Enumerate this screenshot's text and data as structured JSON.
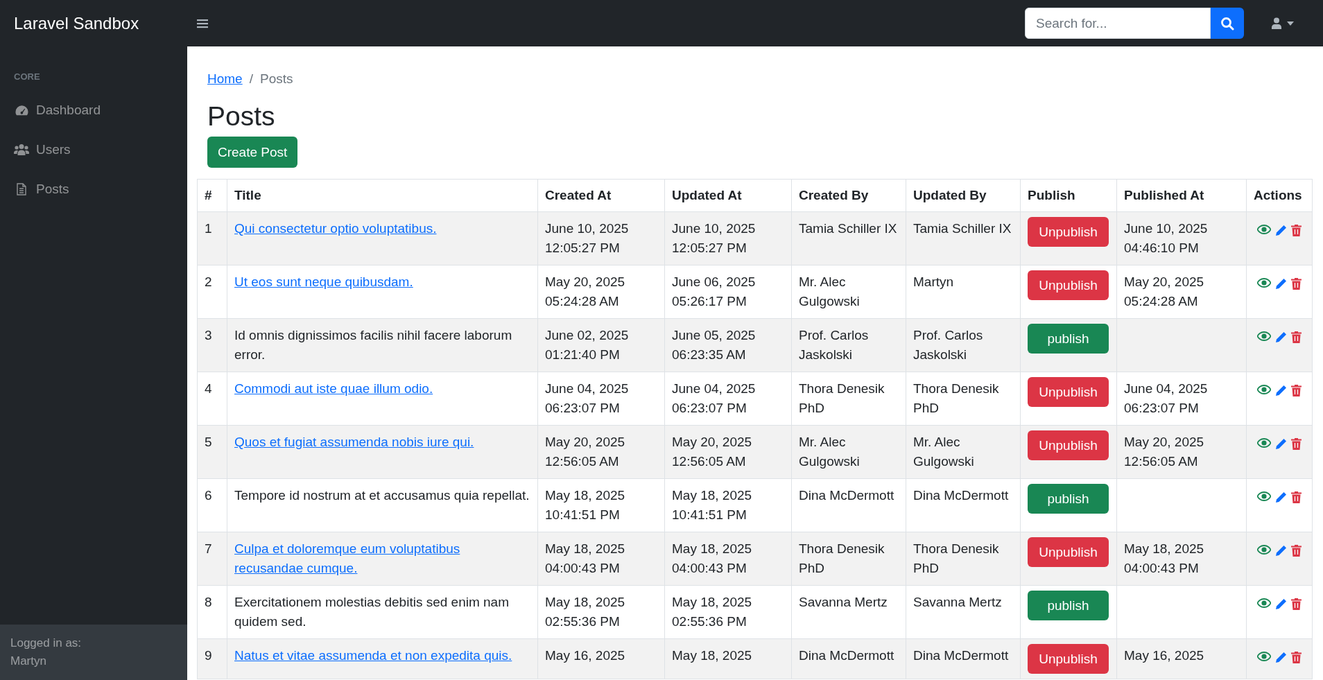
{
  "brand": "Laravel Sandbox",
  "search": {
    "placeholder": "Search for..."
  },
  "sidebar": {
    "heading": "CORE",
    "items": [
      {
        "label": "Dashboard",
        "kind": "dashboard",
        "selected": false
      },
      {
        "label": "Users",
        "kind": "users",
        "selected": false
      },
      {
        "label": "Posts",
        "kind": "posts",
        "selected": false
      }
    ],
    "footer": {
      "label": "Logged in as:",
      "user": "Martyn"
    }
  },
  "breadcrumb": {
    "items": [
      {
        "label": "Home",
        "link": true
      },
      {
        "label": "Posts",
        "link": false
      }
    ],
    "separator": "/"
  },
  "page_title": "Posts",
  "create_button": "Create Post",
  "table": {
    "columns": [
      "#",
      "Title",
      "Created At",
      "Updated At",
      "Created By",
      "Updated By",
      "Publish",
      "Published At",
      "Actions"
    ],
    "rows": [
      {
        "num": "1",
        "title": "Qui consectetur optio voluptatibus.",
        "link": true,
        "created_at": "June 10, 2025 12:05:27 PM",
        "updated_at": "June 10, 2025 12:05:27 PM",
        "created_by": "Tamia Schiller IX",
        "updated_by": "Tamia Schiller IX",
        "publish": {
          "kind": "unpublish",
          "label": "Unpublish"
        },
        "published_at": "June 10, 2025 04:46:10 PM"
      },
      {
        "num": "2",
        "title": "Ut eos sunt neque quibusdam.",
        "link": true,
        "created_at": "May 20, 2025 05:24:28 AM",
        "updated_at": "June 06, 2025 05:26:17 PM",
        "created_by": "Mr. Alec Gulgowski",
        "updated_by": "Martyn",
        "publish": {
          "kind": "unpublish",
          "label": "Unpublish"
        },
        "published_at": "May 20, 2025 05:24:28 AM"
      },
      {
        "num": "3",
        "title": "Id omnis dignissimos facilis nihil facere laborum error.",
        "link": false,
        "created_at": "June 02, 2025 01:21:40 PM",
        "updated_at": "June 05, 2025 06:23:35 AM",
        "created_by": "Prof. Carlos Jaskolski",
        "updated_by": "Prof. Carlos Jaskolski",
        "publish": {
          "kind": "publish",
          "label": "publish"
        },
        "published_at": ""
      },
      {
        "num": "4",
        "title": "Commodi aut iste quae illum odio.",
        "link": true,
        "created_at": "June 04, 2025 06:23:07 PM",
        "updated_at": "June 04, 2025 06:23:07 PM",
        "created_by": "Thora Denesik PhD",
        "updated_by": "Thora Denesik PhD",
        "publish": {
          "kind": "unpublish",
          "label": "Unpublish"
        },
        "published_at": "June 04, 2025 06:23:07 PM"
      },
      {
        "num": "5",
        "title": "Quos et fugiat assumenda nobis iure qui.",
        "link": true,
        "created_at": "May 20, 2025 12:56:05 AM",
        "updated_at": "May 20, 2025 12:56:05 AM",
        "created_by": "Mr. Alec Gulgowski",
        "updated_by": "Mr. Alec Gulgowski",
        "publish": {
          "kind": "unpublish",
          "label": "Unpublish"
        },
        "published_at": "May 20, 2025 12:56:05 AM"
      },
      {
        "num": "6",
        "title": "Tempore id nostrum at et accusamus quia repellat.",
        "link": false,
        "created_at": "May 18, 2025 10:41:51 PM",
        "updated_at": "May 18, 2025 10:41:51 PM",
        "created_by": "Dina McDermott",
        "updated_by": "Dina McDermott",
        "publish": {
          "kind": "publish",
          "label": "publish"
        },
        "published_at": ""
      },
      {
        "num": "7",
        "title": "Culpa et doloremque eum voluptatibus recusandae cumque.",
        "link": true,
        "created_at": "May 18, 2025 04:00:43 PM",
        "updated_at": "May 18, 2025 04:00:43 PM",
        "created_by": "Thora Denesik PhD",
        "updated_by": "Thora Denesik PhD",
        "publish": {
          "kind": "unpublish",
          "label": "Unpublish"
        },
        "published_at": "May 18, 2025 04:00:43 PM"
      },
      {
        "num": "8",
        "title": "Exercitationem molestias debitis sed enim nam quidem sed.",
        "link": false,
        "created_at": "May 18, 2025 02:55:36 PM",
        "updated_at": "May 18, 2025 02:55:36 PM",
        "created_by": "Savanna Mertz",
        "updated_by": "Savanna Mertz",
        "publish": {
          "kind": "publish",
          "label": "publish"
        },
        "published_at": ""
      },
      {
        "num": "9",
        "title": "Natus et vitae assumenda et non expedita quis.",
        "link": true,
        "created_at": "May 16, 2025",
        "updated_at": "May 18, 2025",
        "created_by": "Dina McDermott",
        "updated_by": "Dina McDermott",
        "publish": {
          "kind": "unpublish",
          "label": "Unpublish"
        },
        "published_at": "May 16, 2025"
      }
    ]
  }
}
